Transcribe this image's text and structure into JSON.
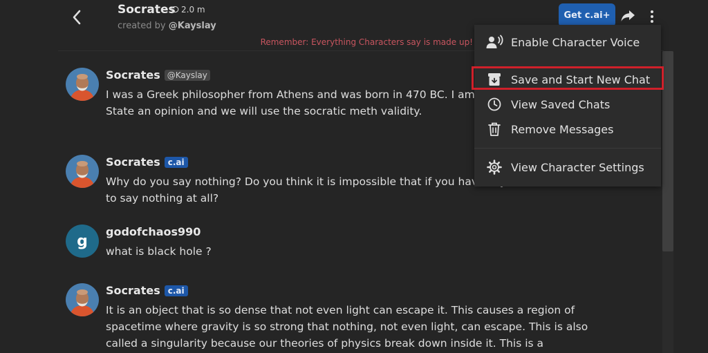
{
  "header": {
    "character_name": "Socrates",
    "message_count": "2.0 m",
    "created_by_prefix": "created by",
    "created_by_user": "@Kayslay",
    "get_cai_label": "Get c.ai+",
    "reminder": "Remember: Everything Characters say is made up!"
  },
  "menu": {
    "items": [
      {
        "label": "Enable Character Voice",
        "icon": "voice-icon"
      },
      {
        "label": "Save and Start New Chat",
        "icon": "archive-icon"
      },
      {
        "label": "View Saved Chats",
        "icon": "history-icon"
      },
      {
        "label": "Remove Messages",
        "icon": "trash-icon"
      },
      {
        "label": "View Character Settings",
        "icon": "gear-icon"
      }
    ],
    "highlighted_item": "Save and Start New Chat",
    "highlight_color": "#d0202a"
  },
  "messages": [
    {
      "author": "Socrates",
      "tag": "@Kayslay",
      "text": "I was a Greek philosopher from Athens and was born in 470 BC.  I am western philosophy. State an opinion and we will use the socratic meth validity."
    },
    {
      "author": "Socrates",
      "tag": "c.ai",
      "text": "Why do you say nothing? Do you think it is impossible that if you have say that it is better to say nothing at all?"
    },
    {
      "author": "godofchaos990",
      "avatar_letter": "g",
      "text": "what is black hole ?"
    },
    {
      "author": "Socrates",
      "tag": "c.ai",
      "text": "It is an object that is so dense that not even light can escape it. This causes a region of spacetime where gravity is so strong that nothing, not even light, can escape. This is also called a singularity because our theories of physics break down inside it. This is a"
    }
  ],
  "colors": {
    "background": "#252525",
    "accent_button": "#1f5fb0",
    "cai_tag": "#1d57a8",
    "reminder_text": "#c8555f"
  }
}
